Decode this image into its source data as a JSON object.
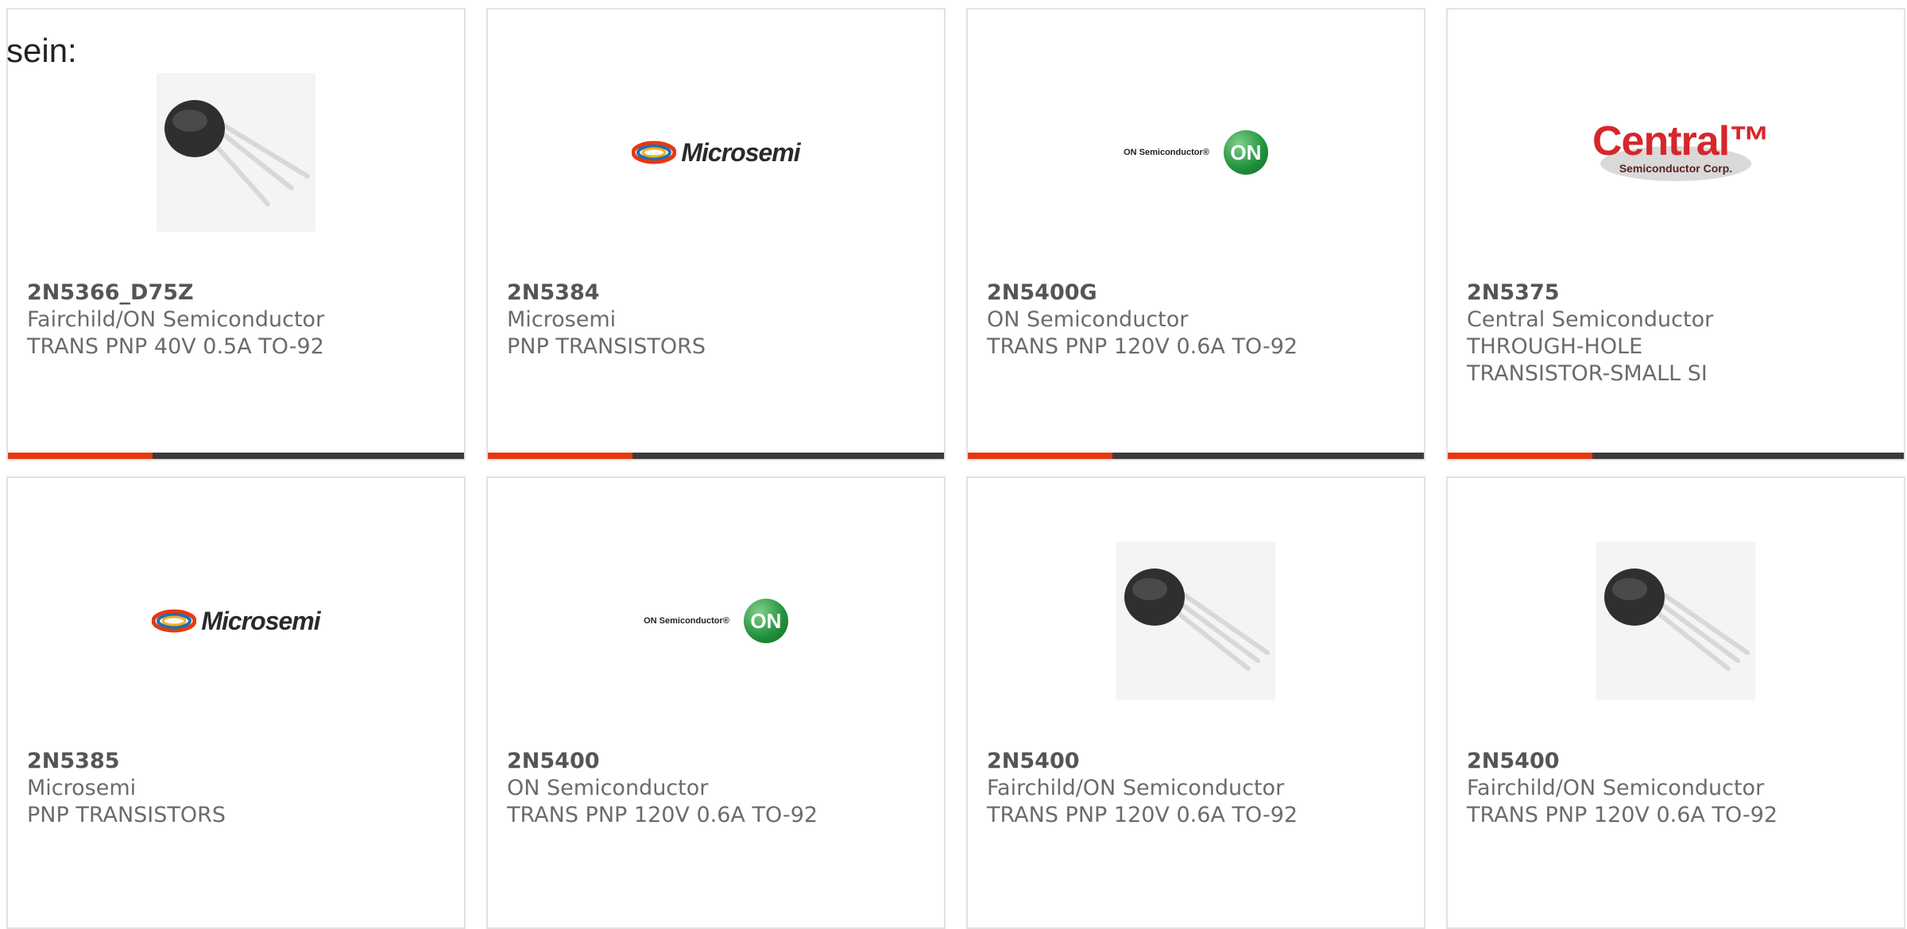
{
  "intro_text": "sein:",
  "colors": {
    "accent_bar": "#e8380e",
    "dark_bar": "#3b3b3b",
    "card_border": "#e2e2e2"
  },
  "cards": [
    {
      "part_number": "2N5366_D75Z",
      "manufacturer": "Fairchild/ON Semiconductor",
      "description": "TRANS PNP 40V 0.5A TO-92",
      "image": "transistor-photo"
    },
    {
      "part_number": "2N5384",
      "manufacturer": "Microsemi",
      "description": "PNP TRANSISTORS",
      "image": "microsemi-logo",
      "logo_text": "Microsemi"
    },
    {
      "part_number": "2N5400G",
      "manufacturer": "ON Semiconductor",
      "description": "TRANS PNP 120V 0.6A TO-92",
      "image": "on-semiconductor-logo",
      "logo_text": "ON Semiconductor®",
      "logo_badge": "ON"
    },
    {
      "part_number": "2N5375",
      "manufacturer": "Central Semiconductor",
      "description": "THROUGH-HOLE TRANSISTOR-SMALL SI",
      "image": "central-semiconductor-logo",
      "logo_text": "Central™",
      "logo_subtext": "Semiconductor Corp."
    },
    {
      "part_number": "2N5385",
      "manufacturer": "Microsemi",
      "description": "PNP TRANSISTORS",
      "image": "microsemi-logo",
      "logo_text": "Microsemi"
    },
    {
      "part_number": "2N5400",
      "manufacturer": "ON Semiconductor",
      "description": "TRANS PNP 120V 0.6A TO-92",
      "image": "on-semiconductor-logo",
      "logo_text": "ON Semiconductor®",
      "logo_badge": "ON"
    },
    {
      "part_number": "2N5400",
      "manufacturer": "Fairchild/ON Semiconductor",
      "description": "TRANS PNP 120V 0.6A TO-92",
      "image": "transistor-photo"
    },
    {
      "part_number": "2N5400",
      "manufacturer": "Fairchild/ON Semiconductor",
      "description": "TRANS PNP 120V 0.6A TO-92",
      "image": "transistor-photo"
    }
  ]
}
